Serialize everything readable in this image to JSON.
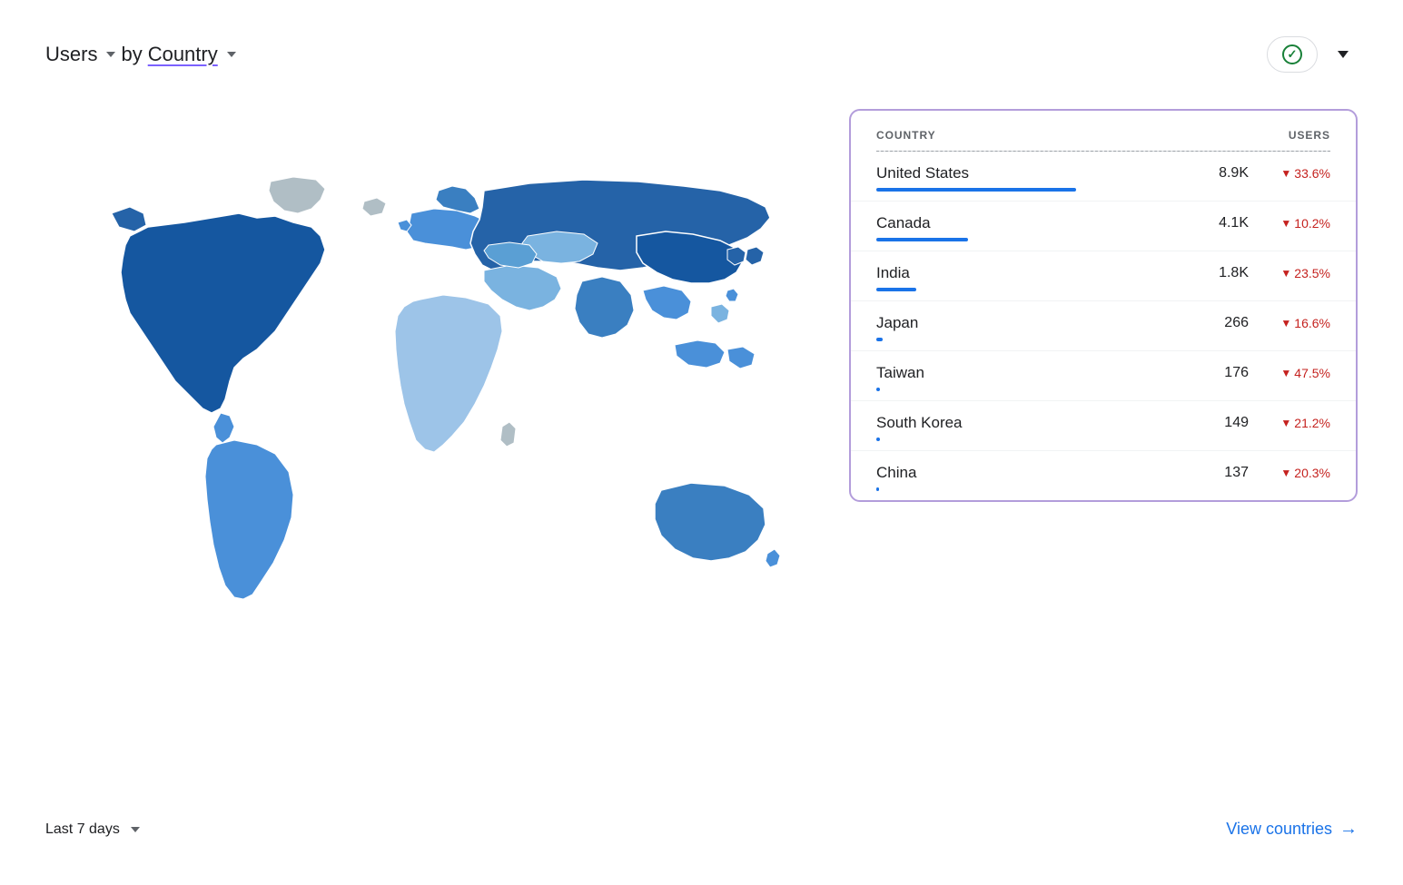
{
  "header": {
    "title_users": "Users",
    "title_by": "by",
    "title_country": "Country",
    "check_label": "check",
    "chevron_label": "chevron"
  },
  "table": {
    "col_country": "COUNTRY",
    "col_users": "USERS",
    "rows": [
      {
        "country": "United States",
        "users": "8.9K",
        "change": "33.6%",
        "bar_pct": 100
      },
      {
        "country": "Canada",
        "users": "4.1K",
        "change": "10.2%",
        "bar_pct": 46
      },
      {
        "country": "India",
        "users": "1.8K",
        "change": "23.5%",
        "bar_pct": 20
      },
      {
        "country": "Japan",
        "users": "266",
        "change": "16.6%",
        "bar_pct": 3
      },
      {
        "country": "Taiwan",
        "users": "176",
        "change": "47.5%",
        "bar_pct": 2
      },
      {
        "country": "South Korea",
        "users": "149",
        "change": "21.2%",
        "bar_pct": 1.7
      },
      {
        "country": "China",
        "users": "137",
        "change": "20.3%",
        "bar_pct": 1.5
      }
    ]
  },
  "footer": {
    "date_range": "Last 7 days",
    "view_countries": "View countries"
  },
  "colors": {
    "accent_purple": "#7b61ff",
    "accent_blue": "#1a73e8",
    "border_purple": "#b39ddb",
    "down_red": "#c5221f",
    "check_green": "#188038"
  }
}
